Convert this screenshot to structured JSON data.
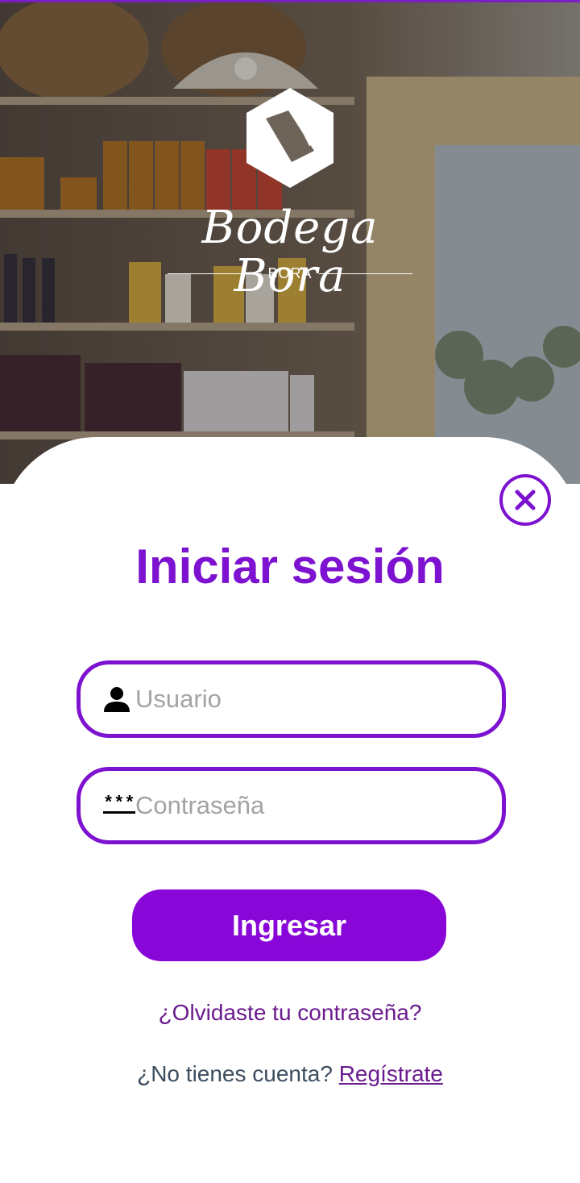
{
  "brand": {
    "name": "Bodega Bora",
    "subtitle": "BORA"
  },
  "login": {
    "title": "Iniciar sesión",
    "username_placeholder": "Usuario",
    "password_placeholder": "Contraseña",
    "password_icon_text": "***",
    "submit_label": "Ingresar",
    "forgot_password_link": "¿Olvidaste tu contraseña?",
    "no_account_text": "¿No tienes cuenta?",
    "register_link": "Regístrate"
  },
  "icons": {
    "close": "close-circle-icon",
    "user": "person-icon",
    "password": "password-asterisks-icon"
  },
  "colors": {
    "accent": "#7d12d0",
    "button": "#8906d9",
    "link": "#6b1b8f",
    "secondary_text": "#3b4d5e"
  }
}
